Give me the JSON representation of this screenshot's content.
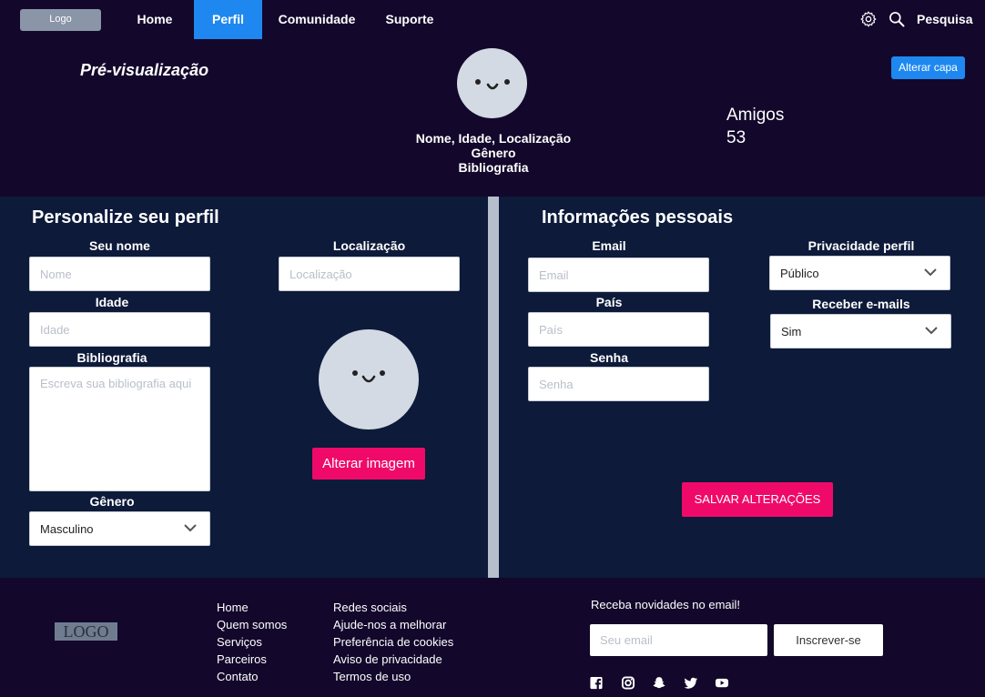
{
  "nav": {
    "logo": "Logo",
    "links": [
      {
        "label": "Home"
      },
      {
        "label": "Perfil"
      },
      {
        "label": "Comunidade"
      },
      {
        "label": "Suporte"
      }
    ],
    "search_label": "Pesquisa"
  },
  "header": {
    "preview_title": "Pré-visualização",
    "info_line1": "Nome, Idade, Localização",
    "info_line2": "Gênero",
    "info_line3": "Bibliografia",
    "friends_label": "Amigos",
    "friends_count": "53",
    "change_cover": "Alterar capa"
  },
  "customize": {
    "title": "Personalize seu perfil",
    "name_label": "Seu nome",
    "name_placeholder": "Nome",
    "age_label": "Idade",
    "age_placeholder": "Idade",
    "bio_label": "Bibliografia",
    "bio_placeholder": "Escreva sua bibliografia aqui",
    "gender_label": "Gênero",
    "gender_value": "Masculino",
    "location_label": "Localização",
    "location_placeholder": "Localização",
    "change_image": "Alterar imagem"
  },
  "personal": {
    "title": "Informações pessoais",
    "email_label": "Email",
    "email_placeholder": "Email",
    "country_label": "País",
    "country_placeholder": "País",
    "password_label": "Senha",
    "password_placeholder": "Senha",
    "privacy_label": "Privacidade perfil",
    "privacy_value": "Público",
    "emails_label": "Receber e-mails",
    "emails_value": "Sim",
    "save": "SALVAR ALTERAÇÕES"
  },
  "footer": {
    "logo": "LOGO",
    "col1": [
      "Home",
      "Quem somos",
      "Serviços",
      "Parceiros",
      "Contato"
    ],
    "col2": [
      "Redes sociais",
      "Ajude-nos a melhorar",
      "Preferência de cookies",
      "Aviso de privacidade",
      "Termos de uso"
    ],
    "newsletter_title": "Receba novidades no email!",
    "newsletter_placeholder": "Seu email",
    "subscribe": "Inscrever-se",
    "social_icons": [
      "facebook-icon",
      "instagram-icon",
      "snapchat-icon",
      "twitter-icon",
      "youtube-icon"
    ]
  },
  "colors": {
    "background": "#13072b",
    "panel": "#0d1a3a",
    "accent_blue": "#1e88f0",
    "accent_pink": "#ef0a6a",
    "divider": "#b6bfcb"
  }
}
